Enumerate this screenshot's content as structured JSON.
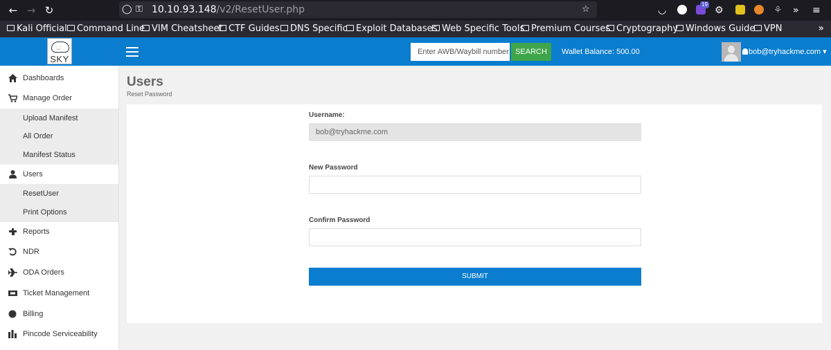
{
  "browser": {
    "url_host": "10.10.93.148",
    "url_path": "/v2/ResetUser.php",
    "extension_badge": "19",
    "bookmarks": [
      "Kali Official",
      "Command Line",
      "VIM Cheatsheet",
      "CTF Guides",
      "DNS Specific",
      "Exploit Databases",
      "Web Specific Tools",
      "Premium Courses",
      "Cryptography",
      "Windows Guide",
      "VPN"
    ]
  },
  "header": {
    "logo_text": "SKY",
    "awb_placeholder": "Enter AWB/Waybill number",
    "search_label": "SEARCH",
    "wallet_text": "Wallet Balance: 500.00",
    "user_email": "bob@tryhackme.com",
    "brand_color": "#0a7dce",
    "search_color": "#3fa54a"
  },
  "sidebar": {
    "items": [
      {
        "label": "Dashboards",
        "icon": "home-icon"
      },
      {
        "label": "Manage Order",
        "icon": "cart-icon"
      },
      {
        "label": "Upload Manifest"
      },
      {
        "label": "All Order"
      },
      {
        "label": "Manifest Status"
      },
      {
        "label": "Users",
        "icon": "user-icon"
      },
      {
        "label": "ResetUser"
      },
      {
        "label": "Print Options"
      },
      {
        "label": "Reports",
        "icon": "puzzle-icon"
      },
      {
        "label": "NDR",
        "icon": "undo-icon"
      },
      {
        "label": "ODA Orders",
        "icon": "plane-icon"
      },
      {
        "label": "Ticket Management",
        "icon": "ticket-icon"
      },
      {
        "label": "Billing",
        "icon": "circle-icon"
      },
      {
        "label": "Pincode Serviceability",
        "icon": "bar-chart-icon"
      }
    ]
  },
  "main": {
    "title": "Users",
    "subtitle": "Reset Password",
    "form": {
      "username_label": "Username:",
      "username_value": "bob@tryhackme.com",
      "new_password_label": "New Password",
      "confirm_password_label": "Confirm Password",
      "submit_label": "SUBMIT"
    }
  }
}
